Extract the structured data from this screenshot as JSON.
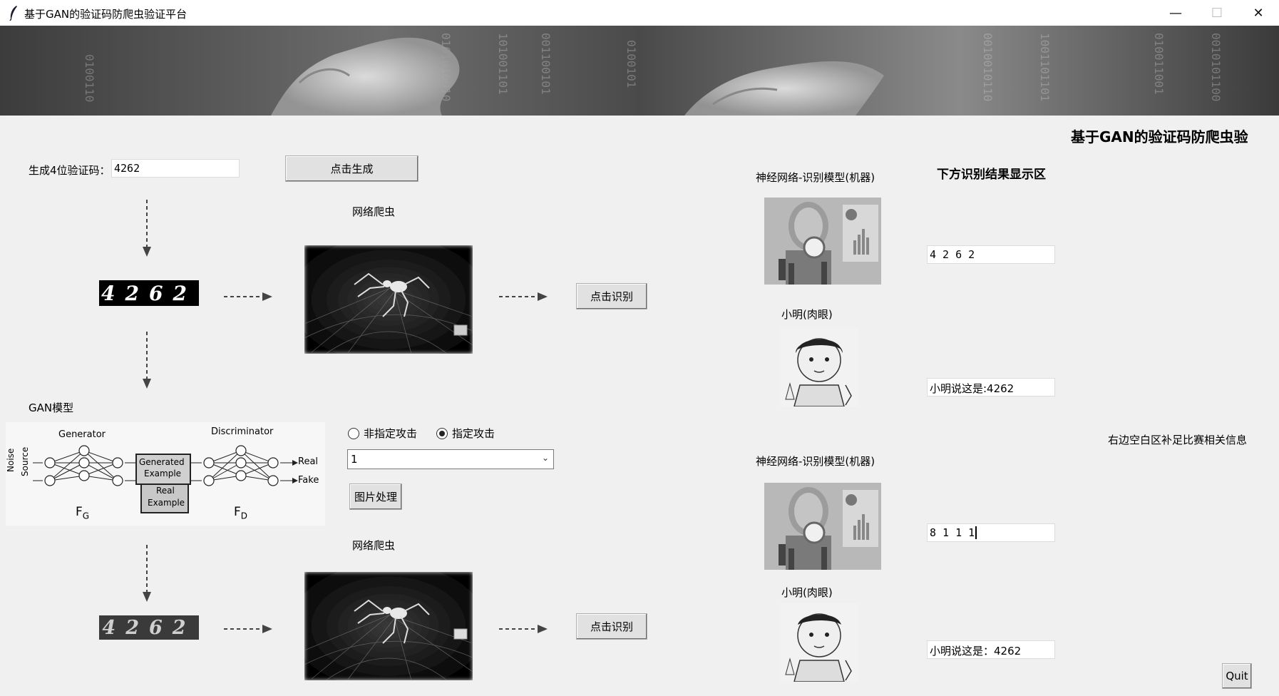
{
  "window": {
    "title": "基于GAN的验证码防爬虫验证平台",
    "min_symbol": "—",
    "max_symbol": "☐",
    "close_symbol": "✕"
  },
  "banner": {
    "heading": "基于GAN的验证码防爬虫验"
  },
  "left": {
    "gen_label": "生成4位验证码：",
    "gen_value": "4262",
    "gen_button": "点击生成",
    "captcha_text": "4262",
    "crawler_label_1": "网络爬虫",
    "recognize_button_1": "点击识别",
    "gan_label": "GAN模型",
    "crawler_label_2": "网络爬虫",
    "recognize_button_2": "点击识别",
    "adv_captcha_text": "4262"
  },
  "gan_diagram": {
    "generator": "Generator",
    "discriminator": "Discriminator",
    "noise": "Noise",
    "source": "Source",
    "generated": "Generated",
    "example": "Example",
    "real": "Real",
    "real_example": "Example",
    "out_real": "Real",
    "out_fake": "Fake",
    "fg": "F",
    "fg_sub": "G",
    "fd": "F",
    "fd_sub": "D"
  },
  "attack": {
    "option_untargeted": "非指定攻击",
    "option_targeted": "指定攻击",
    "selected": "指定攻击",
    "combo_value": "1",
    "process_button": "图片处理"
  },
  "right": {
    "model_label_1": "神经网络-识别模型(机器)",
    "result_header": "下方识别结果显示区",
    "model_result_1": "4 2 6 2",
    "human_label_1": "小明(肉眼)",
    "human_result_1": "小明说这是:4262",
    "side_note": "右边空白区补足比赛相关信息",
    "model_label_2": "神经网络-识别模型(机器)",
    "model_result_2": "8 1 1 1",
    "human_label_2": "小明(肉眼)",
    "human_result_2": "小明说这是：4262",
    "quit_button": "Quit"
  },
  "colors": {
    "background": "#f0f0f0",
    "titlebar": "#ffffff",
    "banner": "#5a5a5a"
  }
}
